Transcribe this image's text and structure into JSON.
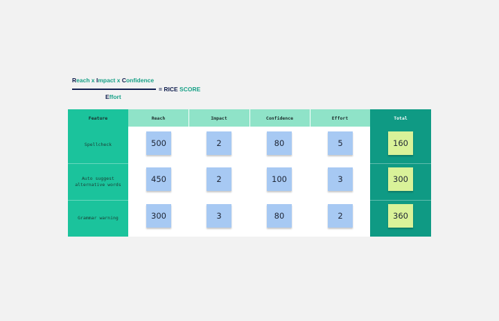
{
  "formula": {
    "numerator": {
      "reach_cap": "R",
      "reach_rest": "each x ",
      "impact_cap": "I",
      "impact_rest": "mpact x ",
      "confidence_cap": "C",
      "confidence_rest": "onfidence"
    },
    "equals": "=",
    "rice": "RICE",
    "score": "SCORE",
    "denominator": {
      "effort_cap": "E",
      "effort_rest": "ffort"
    }
  },
  "table": {
    "headers": [
      "Feature",
      "Reach",
      "Impact",
      "Confidence",
      "Effort",
      "Total"
    ],
    "rows": [
      {
        "feature": "Spellcheck",
        "reach": "500",
        "impact": "2",
        "confidence": "80",
        "effort": "5",
        "total": "160"
      },
      {
        "feature": "Auto suggest alternative words",
        "reach": "450",
        "impact": "2",
        "confidence": "100",
        "effort": "3",
        "total": "300"
      },
      {
        "feature": "Grammar warning",
        "reach": "300",
        "impact": "3",
        "confidence": "80",
        "effort": "2",
        "total": "360"
      }
    ]
  },
  "colors": {
    "navy": "#0d1b4c",
    "teal_text": "#16a086",
    "feature_column": "#1bc39c",
    "header_light": "#8fe3c8",
    "total_column": "#0f9a84",
    "sticky_blue": "#a7c9f3",
    "sticky_green": "#d9f299"
  }
}
